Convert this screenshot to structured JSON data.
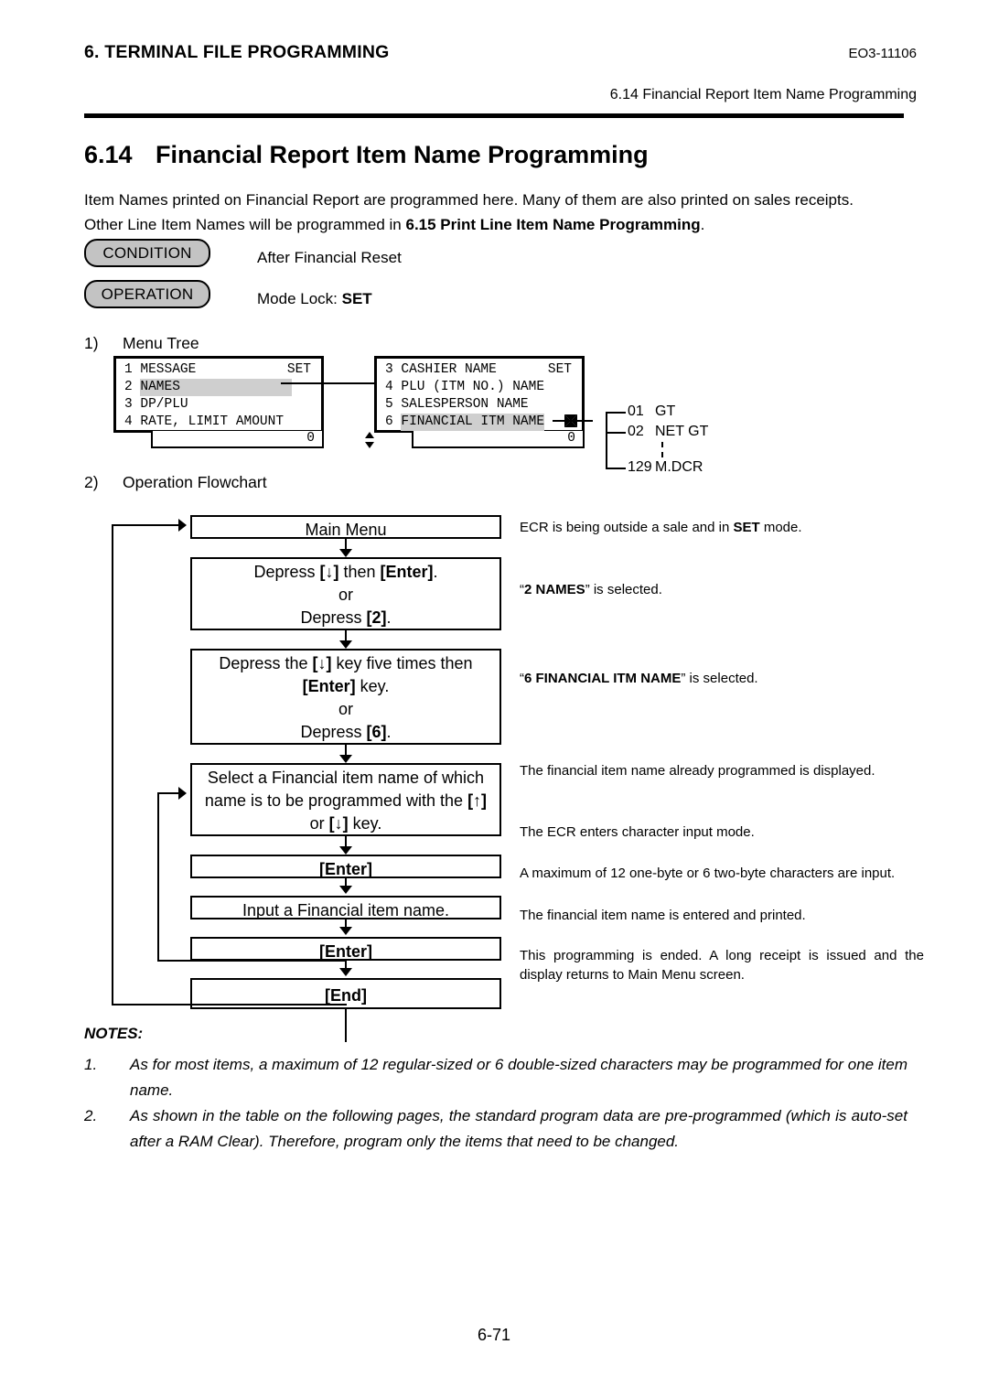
{
  "header": {
    "left": "6. TERMINAL FILE PROGRAMMING",
    "doc_code": "EO3-11106",
    "running_title": "6.14 Financial Report Item Name Programming"
  },
  "section": {
    "number": "6.14",
    "title": "Financial Report Item Name Programming"
  },
  "intro": {
    "line1": "Item Names printed on Financial Report are programmed here.  Many of them are also printed on sales receipts.",
    "line2_pre": "Other Line Item Names will be programmed in ",
    "line2_bold": "6.15 Print Line Item Name Programming",
    "line2_post": "."
  },
  "condition": {
    "label": "CONDITION",
    "value": "After Financial Reset"
  },
  "operation": {
    "label": "OPERATION",
    "value_pre": "Mode Lock: ",
    "value_bold": "SET"
  },
  "steps": {
    "step1_num": "1)",
    "step1_label": "Menu Tree",
    "step2_num": "2)",
    "step2_label": "Operation Flowchart"
  },
  "menu_tree": {
    "lcd1": {
      "rows": [
        {
          "num": "1",
          "text": "MESSAGE",
          "right": "SET",
          "highlight": false
        },
        {
          "num": "2",
          "text": "NAMES",
          "right": "",
          "highlight": true
        },
        {
          "num": "3",
          "text": "DP/PLU",
          "right": "",
          "highlight": false
        },
        {
          "num": "4",
          "text": "RATE, LIMIT AMOUNT",
          "right": "",
          "highlight": false,
          "scroll": true
        }
      ],
      "footer": "0"
    },
    "lcd2": {
      "rows": [
        {
          "num": "3",
          "text": "CASHIER NAME",
          "right": "SET",
          "highlight": false
        },
        {
          "num": "4",
          "text": "PLU (ITM NO.) NAME",
          "right": "",
          "highlight": false
        },
        {
          "num": "5",
          "text": "SALESPERSON NAME",
          "right": "",
          "highlight": false
        },
        {
          "num": "6",
          "text": "FINANCIAL ITM NAME",
          "right": "",
          "highlight": true
        }
      ],
      "footer": "0"
    },
    "branches": [
      {
        "num": "01",
        "name": "GT"
      },
      {
        "num": "02",
        "name": "NET GT"
      },
      {
        "num": "129",
        "name": "M.DCR"
      }
    ]
  },
  "flowchart": {
    "boxes": [
      {
        "name": "main-menu",
        "lines": [
          [
            {
              "t": "Main Menu",
              "b": false
            }
          ]
        ]
      },
      {
        "name": "depress-down-enter-or-2",
        "lines": [
          [
            {
              "t": "Depress ",
              "b": false
            },
            {
              "t": "[↓]",
              "b": true
            },
            {
              "t": " then ",
              "b": false
            },
            {
              "t": "[Enter]",
              "b": true
            },
            {
              "t": ".",
              "b": false
            }
          ],
          [
            {
              "t": "or",
              "b": false
            }
          ],
          [
            {
              "t": "Depress ",
              "b": false
            },
            {
              "t": "[2]",
              "b": true
            },
            {
              "t": ".",
              "b": false
            }
          ]
        ]
      },
      {
        "name": "depress-down-five-times-or-6",
        "lines": [
          [
            {
              "t": "Depress the ",
              "b": false
            },
            {
              "t": "[↓]",
              "b": true
            },
            {
              "t": " key five times then",
              "b": false
            }
          ],
          [
            {
              "t": "[Enter]",
              "b": true
            },
            {
              "t": " key.",
              "b": false
            }
          ],
          [
            {
              "t": "or",
              "b": false
            }
          ],
          [
            {
              "t": "Depress ",
              "b": false
            },
            {
              "t": "[6]",
              "b": true
            },
            {
              "t": ".",
              "b": false
            }
          ]
        ]
      },
      {
        "name": "select-financial-item-name",
        "lines": [
          [
            {
              "t": "Select a Financial item name of which",
              "b": false
            }
          ],
          [
            {
              "t": "name is to be programmed with the ",
              "b": false
            },
            {
              "t": "[↑]",
              "b": true
            }
          ],
          [
            {
              "t": "or ",
              "b": false
            },
            {
              "t": "[↓]",
              "b": true
            },
            {
              "t": " key.",
              "b": false
            }
          ]
        ]
      },
      {
        "name": "enter-1",
        "lines": [
          [
            {
              "t": "[Enter]",
              "b": true
            }
          ]
        ]
      },
      {
        "name": "input-financial-item-name",
        "lines": [
          [
            {
              "t": "Input a Financial item name.",
              "b": false
            }
          ]
        ]
      },
      {
        "name": "enter-2",
        "lines": [
          [
            {
              "t": "[Enter]",
              "b": true
            }
          ]
        ]
      },
      {
        "name": "end",
        "lines": [
          [
            {
              "t": "[End]",
              "b": true
            }
          ]
        ]
      }
    ],
    "notes": {
      "n1_pre": "ECR is being outside a sale and in ",
      "n1_bold": "SET",
      "n1_post": " mode.",
      "n2_q1": "“",
      "n2_bold": "2 NAMES",
      "n2_post": "” is selected.",
      "n3_q1": "“",
      "n3_bold": "6 FINANCIAL ITM NAME",
      "n3_post": "” is selected.",
      "n4": "The financial item name already programmed is displayed.",
      "n5": "The ECR enters character input mode.",
      "n6": "A maximum of 12 one-byte or 6 two-byte characters are input.",
      "n7": "The financial item name is entered and printed.",
      "n8": "This programming is ended.  A long receipt is issued and the display returns to Main Menu screen."
    }
  },
  "notes_section": {
    "title": "NOTES:",
    "items": [
      {
        "num": "1.",
        "text": "As for most items, a maximum of 12 regular-sized or 6 double-sized characters may be programmed for one item name."
      },
      {
        "num": "2.",
        "text": "As shown in the table on the following pages, the standard program data are pre-programmed (which is auto-set after a RAM Clear).  Therefore, program only the items that need to be changed."
      }
    ]
  },
  "footer": {
    "page_number": "6-71"
  },
  "colors": {
    "highlight": "#cfcfcf",
    "pill_fill": "#c3c3c3",
    "line": "#000000"
  }
}
